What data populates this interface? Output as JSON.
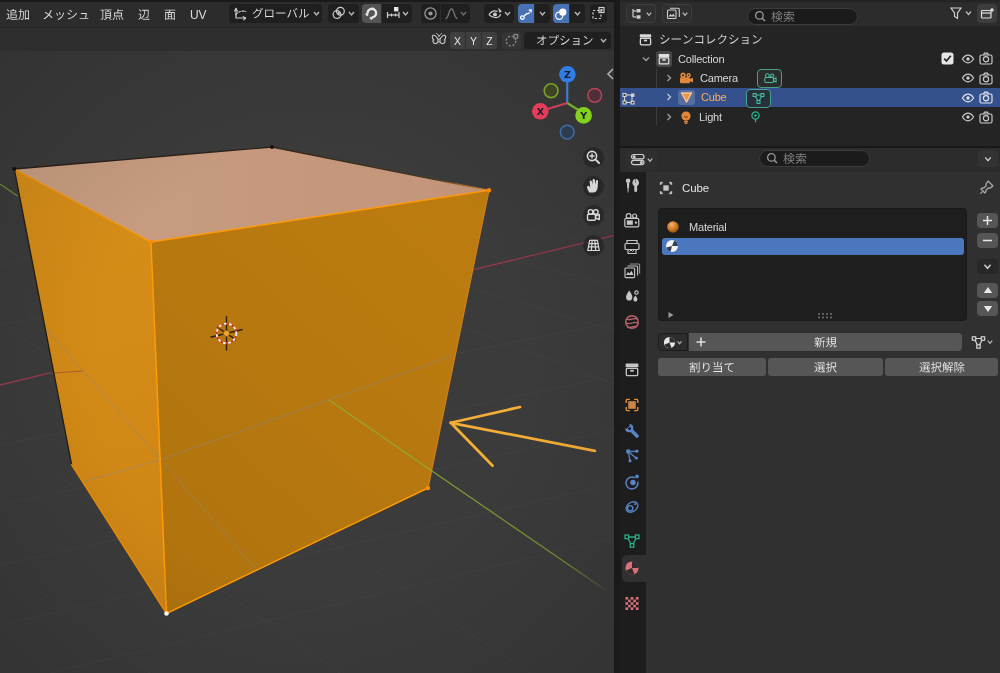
{
  "app": "Blender",
  "viewport": {
    "menus": [
      {
        "label": "追加"
      },
      {
        "label": "メッシュ"
      },
      {
        "label": "頂点"
      },
      {
        "label": "辺"
      },
      {
        "label": "面"
      },
      {
        "label": "UV"
      }
    ],
    "transform_orientation": {
      "value": "グローバル",
      "icon": "orientation-global-icon"
    },
    "toolbar_icons": [
      "pivot-point",
      "snap-magnet",
      "snap-increment",
      "proportional-editing",
      "proportional-falloff",
      "show-gizmo",
      "gizmo-toggle",
      "overlays-toggle",
      "xray-toggle"
    ],
    "snap_magnet_active": true,
    "gizmo_active": true,
    "overlays_active": true,
    "tool_settings": {
      "mirror_label": "ミラー",
      "axis_buttons": [
        "X",
        "Y",
        "Z"
      ],
      "options_label": "オプション"
    },
    "nav_gizmo": {
      "axes": [
        "X",
        "Y",
        "Z"
      ],
      "x_color": "#dc5066",
      "y_color": "#7fc625",
      "z_color": "#3b7de2"
    },
    "nav_buttons": [
      "zoom",
      "pan-hand",
      "camera-view",
      "toggle-grid-ortho"
    ],
    "scene_object": "Cube",
    "mode": "Edit Mode",
    "accent_orange": "#e08900",
    "arrow_annotation_color": "#f5ae35"
  },
  "outliner": {
    "search_placeholder": "検索",
    "rows": [
      {
        "label": "シーンコレクション",
        "icon": "scene-collection-icon",
        "indent": 0
      },
      {
        "label": "Collection",
        "icon": "collection-icon",
        "indent": 1,
        "expanded": true,
        "checkbox": true,
        "eye": true,
        "camera": true
      },
      {
        "label": "Camera",
        "icon": "camera-object-icon",
        "data_icon": "camera-data-icon",
        "indent": 2,
        "eye": true,
        "camera": true
      },
      {
        "label": "Cube",
        "icon": "mesh-object-icon",
        "data_icon": "mesh-data-icon",
        "indent": 2,
        "selected": true,
        "edit_mode": true,
        "eye": true,
        "camera": true
      },
      {
        "label": "Light",
        "icon": "light-object-icon",
        "data_icon": "light-data-icon",
        "indent": 2,
        "eye": true,
        "camera": true
      }
    ],
    "selected_row_color": "#35518d",
    "selected_text_color": "#ffb24d"
  },
  "properties": {
    "search_placeholder": "検索",
    "breadcrumb": {
      "object": "Cube"
    },
    "tabs": [
      "tool",
      "render",
      "output",
      "view-layer",
      "scene",
      "world",
      "collection",
      "object",
      "modifiers",
      "particles",
      "physics",
      "constraints",
      "object-data",
      "material",
      "texture"
    ],
    "active_tab": "material",
    "material_slots": [
      {
        "name": "Material",
        "icon": "material-preview-orange"
      },
      {
        "name": "",
        "icon": "material-generic",
        "selected": true
      }
    ],
    "slot_list_buttons": [
      "add-slot",
      "remove-slot",
      "specials-menu",
      "move-up",
      "move-down"
    ],
    "new_button": "新規",
    "assign_button": "割り当て",
    "select_button": "選択",
    "deselect_button": "選択解除",
    "slot_selected_color": "#4a77bd"
  }
}
